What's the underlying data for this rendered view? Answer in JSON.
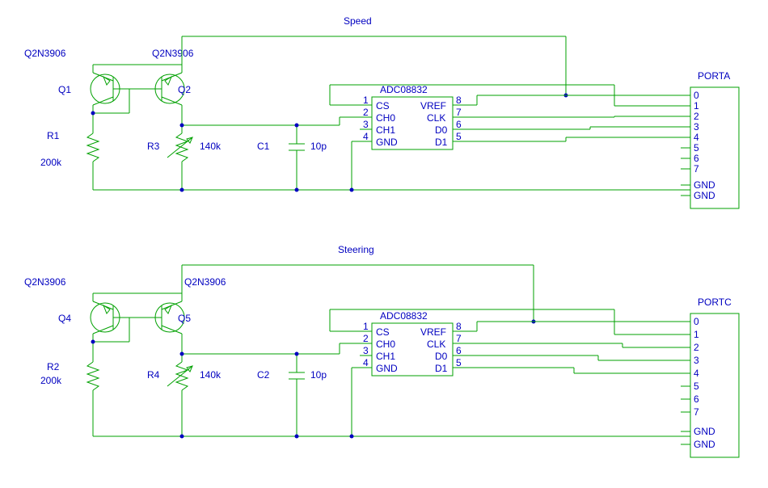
{
  "title_top": "Speed",
  "title_bottom": "Steering",
  "top": {
    "q1": {
      "part": "Q2N3906",
      "ref": "Q1"
    },
    "q2": {
      "part": "Q2N3906",
      "ref": "Q2"
    },
    "r1": {
      "ref": "R1",
      "value": "200k"
    },
    "r3": {
      "ref": "R3",
      "value": "140k"
    },
    "c1": {
      "ref": "C1",
      "value": "10p"
    },
    "adc": {
      "part": "ADC08832",
      "pin1": "1",
      "pin2": "2",
      "pin3": "3",
      "pin4": "4",
      "pin5": "5",
      "pin6": "6",
      "pin7": "7",
      "pin8": "8",
      "l1": "CS",
      "l2": "CH0",
      "l3": "CH1",
      "l4": "GND",
      "r1": "VREF",
      "r2": "CLK",
      "r3": "D0",
      "r4": "D1"
    },
    "port": {
      "name": "PORTA",
      "p0": "0",
      "p1": "1",
      "p2": "2",
      "p3": "3",
      "p4": "4",
      "p5": "5",
      "p6": "6",
      "p7": "7",
      "g1": "GND",
      "g2": "GND"
    }
  },
  "bottom": {
    "q4": {
      "part": "Q2N3906",
      "ref": "Q4"
    },
    "q5": {
      "part": "Q2N3906",
      "ref": "Q5"
    },
    "r2": {
      "ref": "R2",
      "value": "200k"
    },
    "r4": {
      "ref": "R4",
      "value": "140k"
    },
    "c2": {
      "ref": "C2",
      "value": "10p"
    },
    "adc": {
      "part": "ADC08832",
      "pin1": "1",
      "pin2": "2",
      "pin3": "3",
      "pin4": "4",
      "pin5": "5",
      "pin6": "6",
      "pin7": "7",
      "pin8": "8",
      "l1": "CS",
      "l2": "CH0",
      "l3": "CH1",
      "l4": "GND",
      "r1": "VREF",
      "r2": "CLK",
      "r3": "D0",
      "r4": "D1"
    },
    "port": {
      "name": "PORTC",
      "p0": "0",
      "p1": "1",
      "p2": "2",
      "p3": "3",
      "p4": "4",
      "p5": "5",
      "p6": "6",
      "p7": "7",
      "g1": "GND",
      "g2": "GND"
    }
  }
}
